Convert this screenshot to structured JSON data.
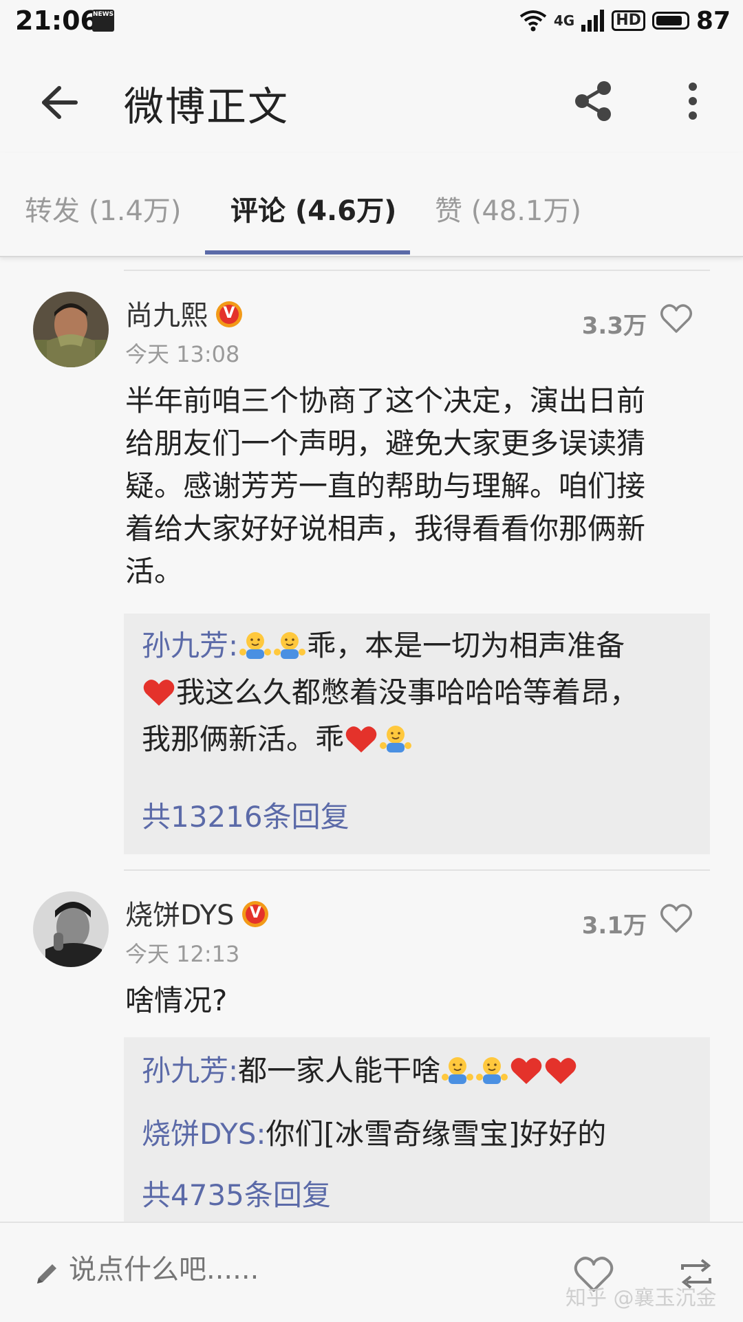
{
  "status_bar": {
    "time": "21:06",
    "news_icon_label": "NEWS",
    "network_type": "4G",
    "hd_label": "HD",
    "battery": "87"
  },
  "header": {
    "title": "微博正文"
  },
  "tabs": [
    {
      "label": "转发 (1.4万)",
      "active": false
    },
    {
      "label": "评论 (4.6万)",
      "active": true
    },
    {
      "label": "赞 (48.1万)",
      "active": false
    }
  ],
  "comments": [
    {
      "author": "尚九熙",
      "time": "今天 13:08",
      "likes": "3.3万",
      "lines": [
        "半年前咱三个协商了这个决定，演出日前",
        "给朋友们一个声明，避免大家更多误读猜",
        "疑。感谢芳芳一直的帮助与理解。咱们接",
        "着给大家好好说相声，我得看看你那俩新",
        "活。"
      ],
      "replies": [
        {
          "name": "孙九芳",
          "seg1": "乖，本是一切为相声准备",
          "seg2": "我这么久都憋着没事哈哈哈等着昂，",
          "seg3": "我那俩新活。乖"
        }
      ],
      "more_replies": "共13216条回复"
    },
    {
      "author": "烧饼DYS",
      "time": "今天 12:13",
      "likes": "3.1万",
      "text": "啥情况?",
      "replies": [
        {
          "name": "孙九芳",
          "text": "都一家人能干啥"
        },
        {
          "name": "烧饼DYS",
          "text": "你们[冰雪奇缘雪宝]好好的"
        }
      ],
      "more_replies": "共4735条回复"
    }
  ],
  "bottom_bar": {
    "placeholder": "说点什么吧......",
    "watermark": "知乎 @襄玉沉金"
  },
  "colors": {
    "accent": "#5b6aa8",
    "badge_orange": "#f29a18",
    "heart_red": "#e4322b"
  },
  "icons": [
    "back-arrow-icon",
    "share-icon",
    "more-vertical-icon",
    "heart-outline-icon",
    "verified-badge-icon",
    "hug-emoji-icon",
    "red-heart-emoji-icon",
    "pencil-icon",
    "repost-icon"
  ]
}
